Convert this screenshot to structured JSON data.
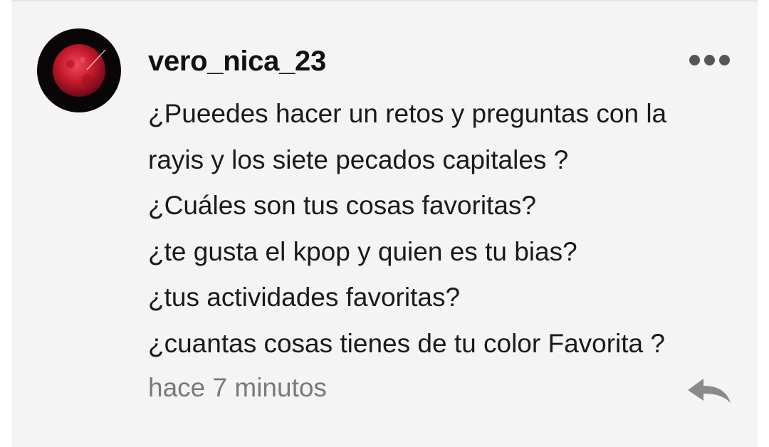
{
  "comment": {
    "author": "vero_nica_23",
    "avatar": {
      "icon": "red-moon-avatar",
      "accent": "#c3192b"
    },
    "lines": [
      "¿Pueedes hacer un retos y preguntas con la",
      "rayis y los siete pecados capitales ?",
      "¿Cuáles son tus cosas favoritas?",
      "¿te gusta el kpop y quien es tu bias?",
      "¿tus actividades favoritas?",
      "¿cuantas cosas tienes de tu color Favorita ?"
    ],
    "timestamp": "hace 7 minutos",
    "more_icon": "more-dots-icon",
    "reply_icon": "reply-arrow-icon"
  },
  "colors": {
    "card_background": "#f4f4f4",
    "text": "#1a1a1a",
    "muted": "#7a7a7a",
    "icon": "#555555"
  }
}
